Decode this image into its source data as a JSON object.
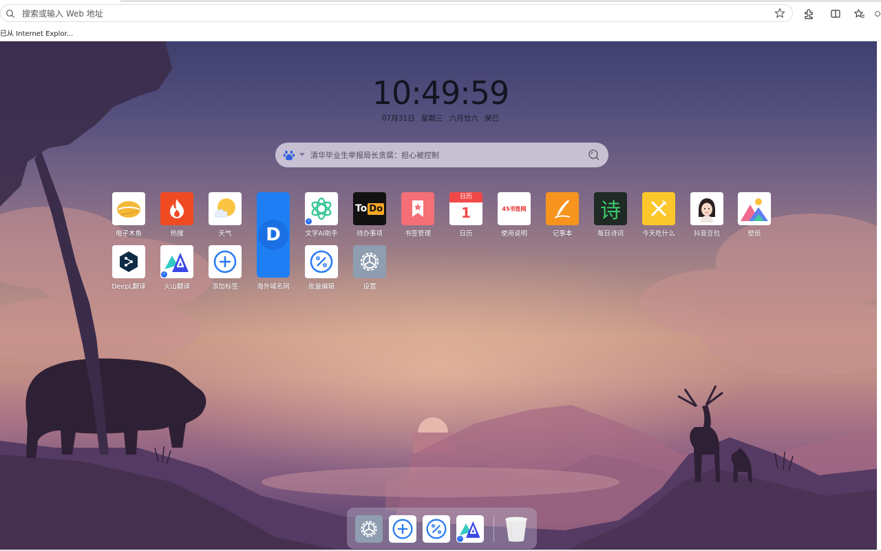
{
  "browser": {
    "address_placeholder": "搜索或输入 Web 地址",
    "favorites_item": "已从 Internet Explor...",
    "icons": [
      "search-icon",
      "star-icon",
      "extensions-icon",
      "split-screen-icon",
      "favorites-icon"
    ]
  },
  "clock": {
    "time": "10:49:59",
    "date": "07月31日  星期三  六月廿六  癸巳"
  },
  "search": {
    "engine": "baidu-icon",
    "placeholder": "清华毕业生举报局长贪腐：担心被控制"
  },
  "apps": [
    {
      "label": "电子木鱼",
      "icon": "wooden-fish-icon"
    },
    {
      "label": "热搜",
      "icon": "flame-icon"
    },
    {
      "label": "天气",
      "icon": "weather-icon"
    },
    {
      "label": "海外域名网",
      "icon": "domain-d-icon",
      "glyph": "D"
    },
    {
      "label": "文学AI助手",
      "icon": "openai-icon"
    },
    {
      "label": "待办事项",
      "icon": "todo-icon",
      "glyph": "To",
      "glyph2": "Do"
    },
    {
      "label": "书签管理",
      "icon": "bookmark-icon"
    },
    {
      "label": "日历",
      "icon": "calendar-icon",
      "top": "日历",
      "day": "1"
    },
    {
      "label": "使用说明",
      "icon": "manual-icon",
      "glyph": "45书签网"
    },
    {
      "label": "记事本",
      "icon": "notepad-icon"
    },
    {
      "label": "每日诗词",
      "icon": "poem-icon",
      "glyph": "诗"
    },
    {
      "label": "今天吃什么",
      "icon": "fork-knife-icon"
    },
    {
      "label": "抖音豆包",
      "icon": "avatar-icon"
    },
    {
      "label": "壁纸",
      "icon": "wallpaper-icon"
    },
    {
      "label": "DeepL翻译",
      "icon": "deepl-icon"
    },
    {
      "label": "火山翻译",
      "icon": "volcano-translate-icon",
      "glyph": "A"
    },
    {
      "label": "添加标签",
      "icon": "plus-circle-icon"
    },
    {
      "label": "批量编辑",
      "icon": "percent-circle-icon"
    },
    {
      "label": "设置",
      "icon": "gear-icon"
    }
  ],
  "dock": [
    "gear-icon",
    "plus-circle-icon",
    "percent-circle-icon",
    "volcano-translate-icon",
    "trash-icon"
  ],
  "colors": {
    "accent": "#2b7bf2",
    "todo_yellow": "#f5a623",
    "calendar_red": "#f04848"
  }
}
